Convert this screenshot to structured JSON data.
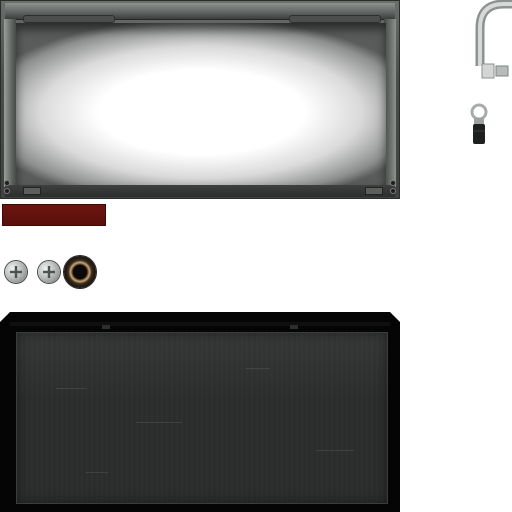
{
  "texture_atlas": {
    "sprites": [
      {
        "id": "frame-panel",
        "kind": "metal-frame-with-lit-screen"
      },
      {
        "id": "red-strip",
        "kind": "color-swatch"
      },
      {
        "id": "screw-one",
        "kind": "phillips-screw"
      },
      {
        "id": "screw-two",
        "kind": "phillips-screw"
      },
      {
        "id": "grommet",
        "kind": "rubber-grommet"
      },
      {
        "id": "hook",
        "kind": "bent-cable-hook"
      },
      {
        "id": "ring-terminal",
        "kind": "ring-connector"
      },
      {
        "id": "dark-panel",
        "kind": "dark-metal-panel"
      }
    ]
  },
  "colors": {
    "background": "#ffffff",
    "frame_metal": "#5a5e5b",
    "screen_glow": "#ffffff",
    "red_strip": "#5f100c",
    "dark_panel_border": "#050505",
    "dark_panel_face": "#2c2e2d",
    "grommet_ring": "#c9a77c"
  },
  "icons": [
    "screw-icon",
    "grommet-icon",
    "hook-icon",
    "ring-terminal-icon"
  ]
}
